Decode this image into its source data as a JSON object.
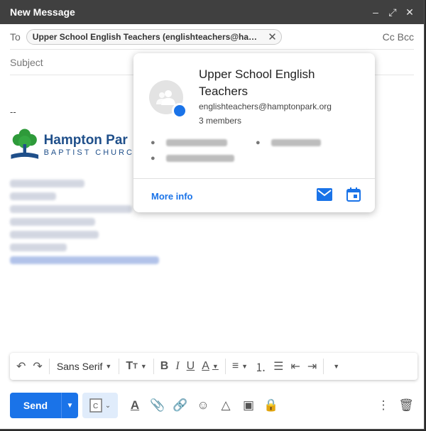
{
  "window": {
    "title": "New Message",
    "minimize": "–",
    "expand": "⤢",
    "close": "✕"
  },
  "to": {
    "label": "To",
    "chip": "Upper School English Teachers (englishteachers@hamp...",
    "cc_bcc": "Cc Bcc"
  },
  "subject": {
    "placeholder": "Subject"
  },
  "body": {
    "signature_dash": "--",
    "logo_name": "Hampton Par",
    "logo_sub": "BAPTIST CHURC"
  },
  "contact_card": {
    "name": "Upper School English Teachers",
    "email": "englishteachers@hamptonpark.org",
    "members": "3 members",
    "more_info": "More info"
  },
  "format_bar": {
    "font": "Sans Serif"
  },
  "actions": {
    "send": "Send"
  },
  "colors": {
    "accent": "#1a73e8",
    "titlebar": "#404040"
  }
}
